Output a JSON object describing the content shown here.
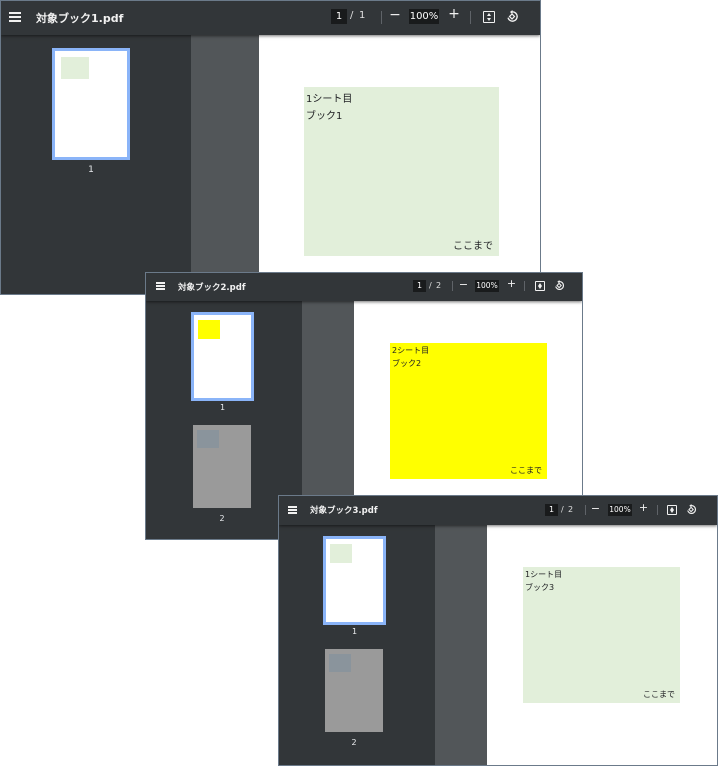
{
  "windows": [
    {
      "filename": "対象ブック1.pdf",
      "current_page": "1",
      "separator": "/",
      "total_pages": "1",
      "zoom": "100%",
      "zoom_out": "−",
      "zoom_in": "+",
      "thumbnails": [
        {
          "label": "1"
        }
      ],
      "sheet": {
        "line1": "1シート目",
        "line2": "ブック1",
        "end": "ここまで",
        "color": "#e2efda"
      }
    },
    {
      "filename": "対象ブック2.pdf",
      "current_page": "1",
      "separator": "/",
      "total_pages": "2",
      "zoom": "100%",
      "zoom_out": "−",
      "zoom_in": "+",
      "thumbnails": [
        {
          "label": "1"
        },
        {
          "label": "2"
        }
      ],
      "sheet": {
        "line1": "2シート目",
        "line2": "ブック2",
        "end": "ここまで",
        "color": "#ffff00"
      }
    },
    {
      "filename": "対象ブック3.pdf",
      "current_page": "1",
      "separator": "/",
      "total_pages": "2",
      "zoom": "100%",
      "zoom_out": "−",
      "zoom_in": "+",
      "thumbnails": [
        {
          "label": "1"
        },
        {
          "label": "2"
        }
      ],
      "sheet": {
        "line1": "1シート目",
        "line2": "ブック3",
        "end": "ここまで",
        "color": "#e2efda"
      }
    }
  ],
  "colors": {
    "toolbar_bg": "#323639",
    "sidebar_bg": "#323639",
    "gutter_bg": "#525659",
    "selected_thumb_border": "#8ab4f8",
    "unselected_thumb": "#9a9a9a"
  }
}
